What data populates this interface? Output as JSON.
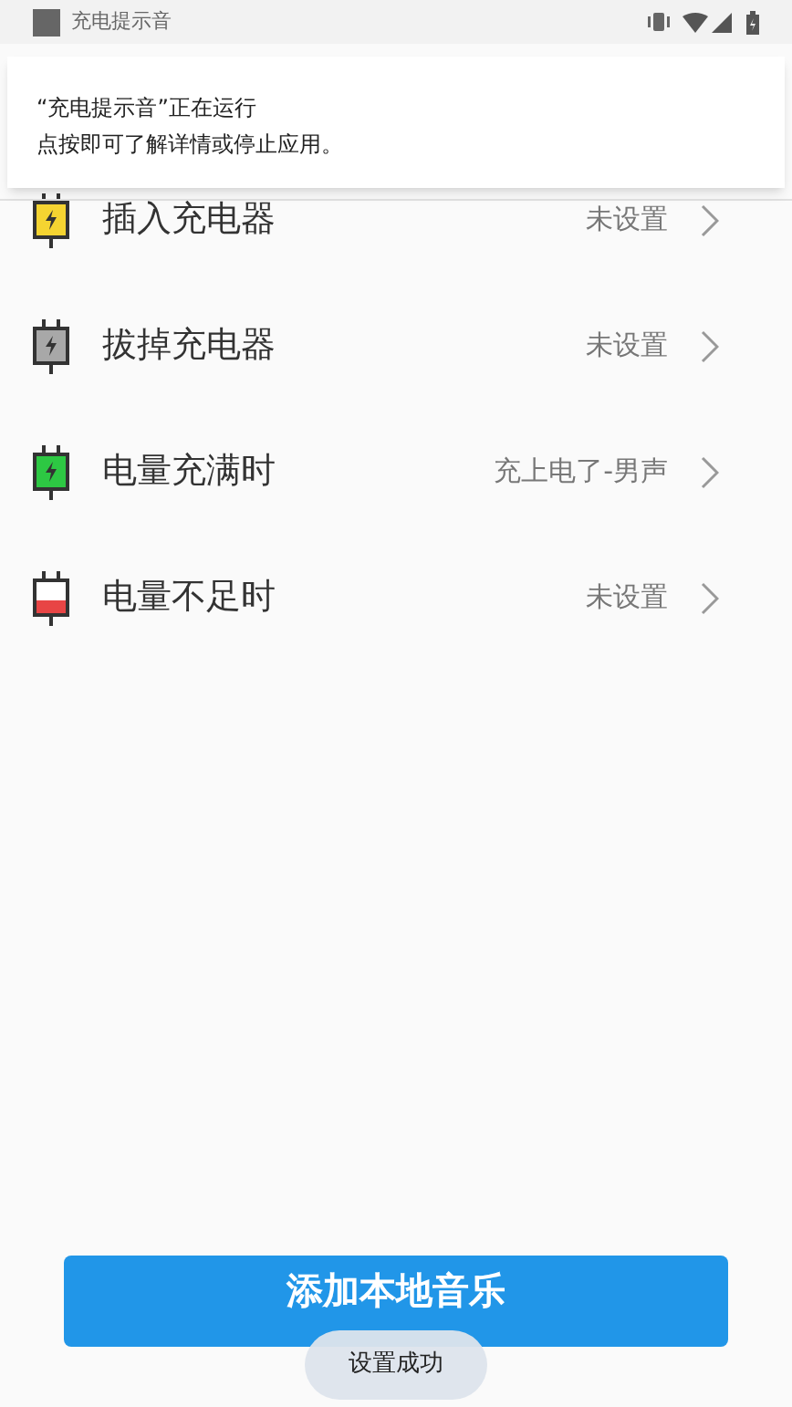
{
  "status_bar": {
    "app_name": "充电提示音"
  },
  "notification": {
    "title": "“充电提示音”正在运行",
    "body": "点按即可了解详情或停止应用。"
  },
  "items": [
    {
      "label": "插入充电器",
      "value": "未设置",
      "kind": "charging",
      "color": "#f5d431"
    },
    {
      "label": "拔掉充电器",
      "value": "未设置",
      "kind": "charging",
      "color": "#a8a8a8"
    },
    {
      "label": "电量充满时",
      "value": "充上电了-男声",
      "kind": "charging",
      "color": "#2dc843"
    },
    {
      "label": "电量不足时",
      "value": "未设置",
      "kind": "low",
      "color": "#e84545"
    }
  ],
  "button": {
    "label": "添加本地音乐"
  },
  "toast": {
    "text": "设置成功"
  }
}
